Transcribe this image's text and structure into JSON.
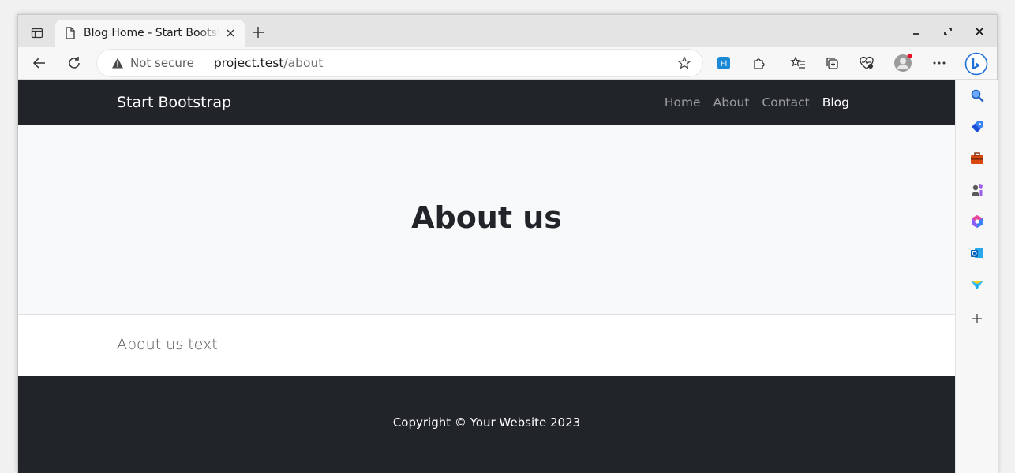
{
  "browser": {
    "tab": {
      "title": "Blog Home - Start Bootstrap"
    },
    "address": {
      "security_label": "Not secure",
      "host": "project.test",
      "path": "/about"
    },
    "icons": {
      "tab_actions": "tab-actions-icon",
      "document": "document-icon",
      "close_tab": "close-icon",
      "new_tab": "plus-icon",
      "minimize": "minimize-icon",
      "maximize": "maximize-icon",
      "close_window": "close-window-icon",
      "back": "back-icon",
      "refresh": "refresh-icon",
      "favorite": "star-icon",
      "translate": "translate-icon",
      "extensions": "puzzle-icon",
      "favorites": "favorites-icon",
      "collections": "collections-icon",
      "performance": "heart-pulse-icon",
      "profile": "profile-icon",
      "more": "more-icon",
      "bing": "bing-icon"
    },
    "sidebar": [
      "search-icon",
      "shopping-tag-icon",
      "toolbox-icon",
      "games-icon",
      "office-icon",
      "outlook-icon",
      "send-icon",
      "add-icon"
    ]
  },
  "page": {
    "brand": "Start Bootstrap",
    "nav": [
      {
        "label": "Home",
        "active": false
      },
      {
        "label": "About",
        "active": false
      },
      {
        "label": "Contact",
        "active": false
      },
      {
        "label": "Blog",
        "active": true
      }
    ],
    "hero_title": "About us",
    "body_text": "About us text",
    "footer_text": "Copyright © Your Website 2023"
  },
  "colors": {
    "navbar_bg": "#212529",
    "hero_bg": "#f8f9fa",
    "nav_active": "#ffffff",
    "nav_inactive": "rgba(255,255,255,0.55)"
  }
}
